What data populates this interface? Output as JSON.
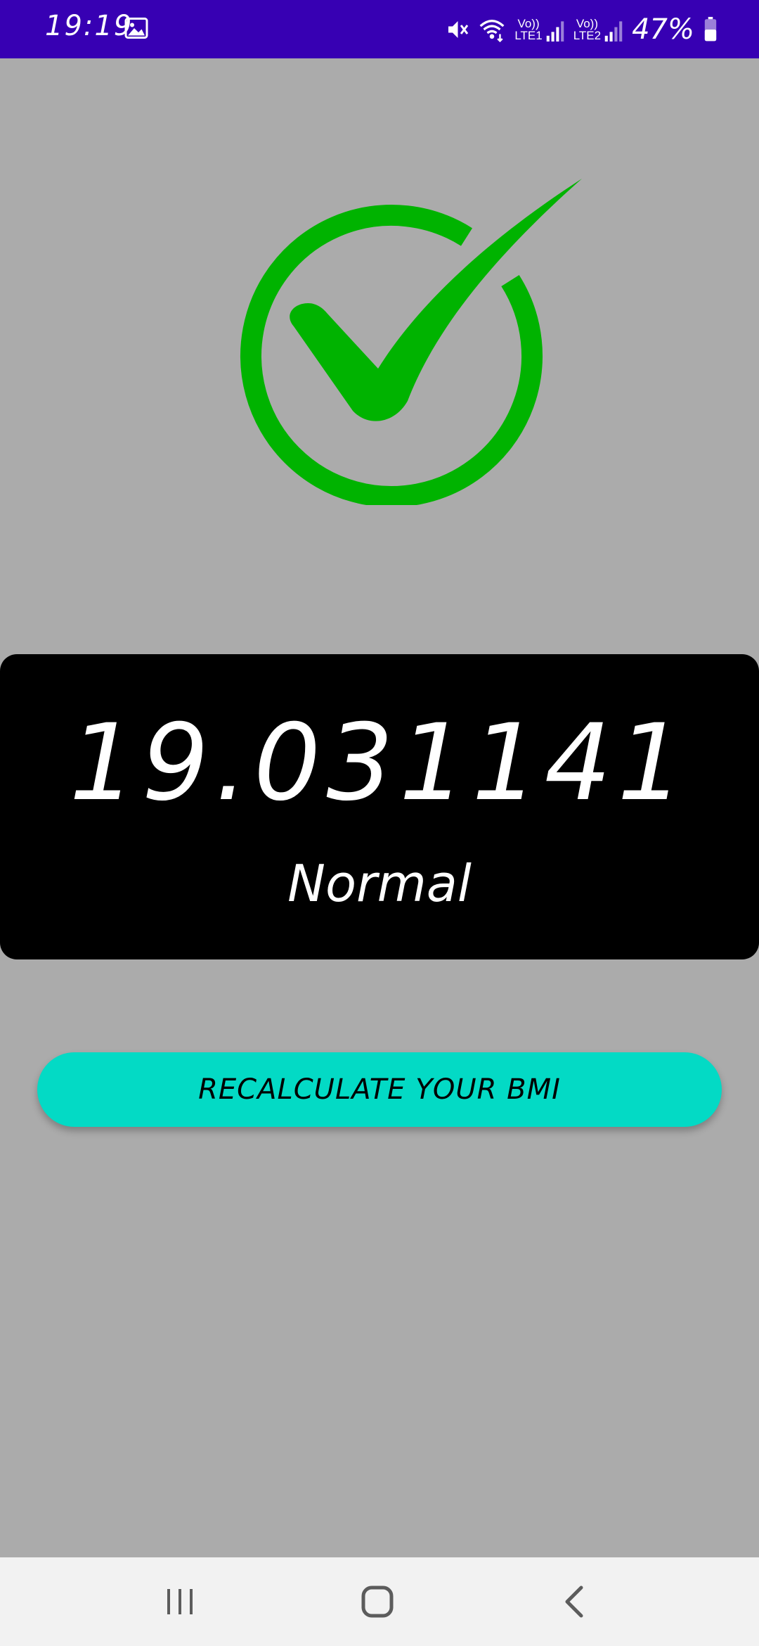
{
  "status_bar": {
    "time": "19:19",
    "battery_percent": "47%",
    "sim1_volte": "Vo))",
    "sim1_label": "LTE1",
    "sim2_volte": "Vo))",
    "sim2_label": "LTE2",
    "icons": [
      "gallery-icon",
      "mute-vibrate-icon",
      "wifi-icon",
      "signal-icon",
      "battery-icon"
    ],
    "background_color": "#3700b3"
  },
  "result": {
    "icon": "check-circle-icon",
    "icon_color": "#00b300",
    "bmi_value": "19.031141",
    "category": "Normal"
  },
  "actions": {
    "recalculate_label": "RECALCULATE YOUR BMI",
    "button_color": "#03dac5"
  },
  "nav_bar": {
    "icons": [
      "recent-apps-icon",
      "home-icon",
      "back-icon"
    ]
  }
}
